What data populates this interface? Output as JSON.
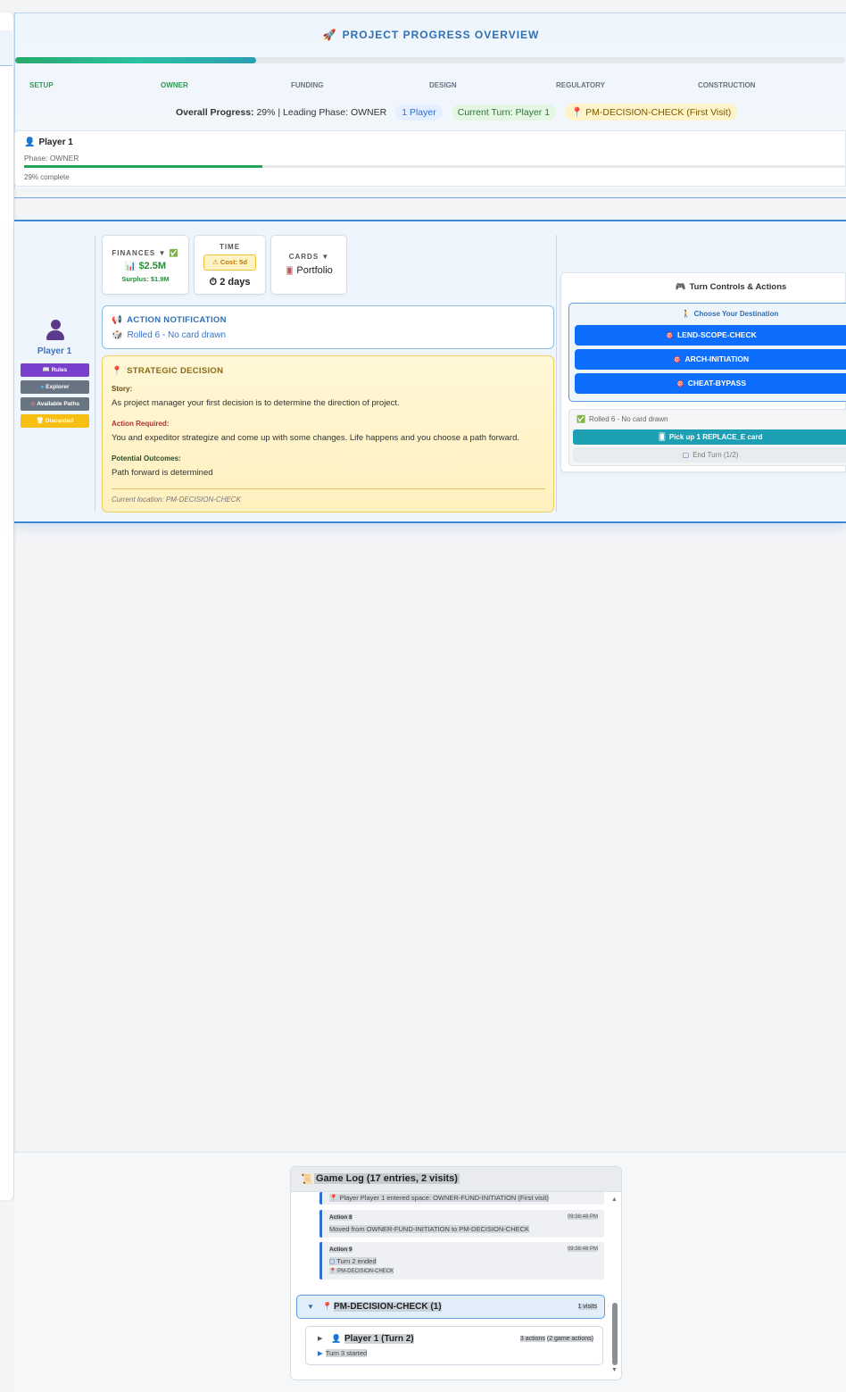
{
  "overview": {
    "icon": "rocket-icon",
    "title": "PROJECT PROGRESS OVERVIEW",
    "progress_fraction": 0.29,
    "phases": [
      "SETUP",
      "OWNER",
      "FUNDING",
      "DESIGN",
      "REGULATORY",
      "CONSTRUCTION"
    ],
    "stats_label": "Overall Progress:",
    "stats_value": "29% | Leading Phase:",
    "leading_phase": "OWNER",
    "players_pill": "1 Player",
    "current_turn": "Current Turn: Player 1",
    "location_pill": "PM-DECISION-CHECK (First Visit)"
  },
  "player_card": {
    "name": "Player 1",
    "phase": "Phase: OWNER",
    "progress_fraction": 0.29,
    "complete": "29% complete"
  },
  "sidebar": {
    "player_name": "Player 1",
    "buttons": [
      "Rules",
      "Explorer",
      "Available Paths",
      "Discarded"
    ]
  },
  "stats": {
    "finances_label": "FINANCES",
    "finances_value": "$2.5M",
    "surplus": "Surplus: $1.9M",
    "time_label": "TIME",
    "cost": "Cost: 5d",
    "days": "2 days",
    "cards_label": "CARDS",
    "portfolio": "Portfolio"
  },
  "notification": {
    "title": "ACTION NOTIFICATION",
    "text": "Rolled 6 - No card drawn"
  },
  "decision": {
    "title": "STRATEGIC DECISION",
    "story_label": "Story:",
    "story": "As project manager your first decision is to determine the direction of project.",
    "action_label": "Action Required:",
    "action": "You and expeditor strategize and come up with some changes. Life happens and you choose a path forward.",
    "outcome_label": "Potential Outcomes:",
    "outcome": "Path forward is determined",
    "location": "Current location: PM-DECISION-CHECK"
  },
  "turn_controls": {
    "title": "Turn Controls & Actions",
    "destination_label": "Choose Your Destination",
    "destinations": [
      "LEND-SCOPE-CHECK",
      "ARCH-INITIATION",
      "CHEAT-BYPASS"
    ],
    "rolled": "Rolled 6 - No card drawn",
    "pickup": "Pick up 1 REPLACE_E card",
    "end_turn": "End Turn (1/2)"
  },
  "game_log": {
    "title": "Game Log (17 entries, 2 visits)",
    "entered": "Player Player 1 entered space: OWNER-FUND-INITIATION (First visit)",
    "entries": [
      {
        "action": "Action 8",
        "time": "09:38:48 PM",
        "text": "Moved from OWNER-FUND-INITIATION to PM-DECISION-CHECK"
      },
      {
        "action": "Action 9",
        "time": "09:38:48 PM",
        "text": "Turn 2 ended",
        "sub": "PM-DECISION-CHECK"
      }
    ],
    "group": {
      "name": "PM-DECISION-CHECK (1)",
      "visits": "1 visits"
    },
    "turn": {
      "name": "Player 1 (Turn 2)",
      "actions": "3 actions",
      "game_actions": "(2 game actions)",
      "started": "Turn 3 started"
    }
  }
}
